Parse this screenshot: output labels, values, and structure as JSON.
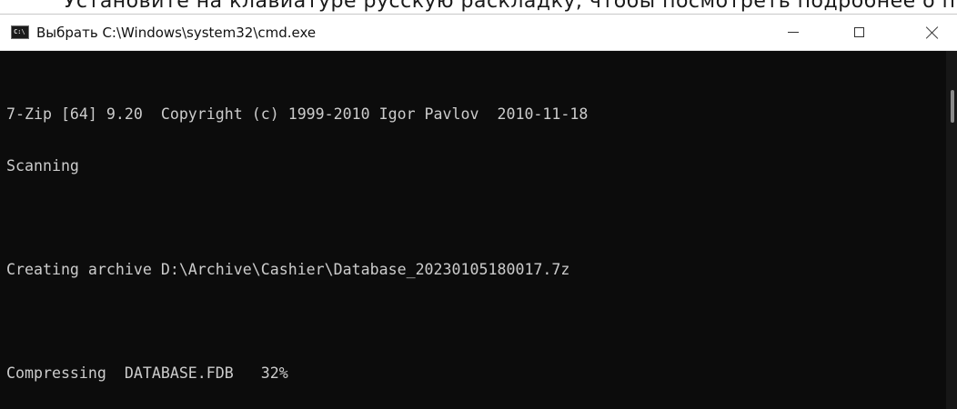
{
  "top_strip": {
    "cut_text": "Установите на клавиатуре русскую раскладку, чтобы посмотреть подробнее о процессе для ПК"
  },
  "window": {
    "title": "Выбрать C:\\Windows\\system32\\cmd.exe",
    "icon_label": "C:\\"
  },
  "console": {
    "lines": [
      "7-Zip [64] 9.20  Copyright (c) 1999-2010 Igor Pavlov  2010-11-18",
      "Scanning",
      "",
      "Creating archive D:\\Archive\\Cashier\\Database_20230105180017.7z",
      "",
      "Compressing  DATABASE.FDB   32%"
    ]
  },
  "icons": {
    "app": "console-app-icon",
    "minimize": "minimize-icon",
    "maximize": "maximize-icon",
    "close": "close-icon"
  },
  "colors": {
    "console_bg": "#0c0c0c",
    "console_fg": "#cccccc",
    "titlebar_bg": "#ffffff"
  }
}
